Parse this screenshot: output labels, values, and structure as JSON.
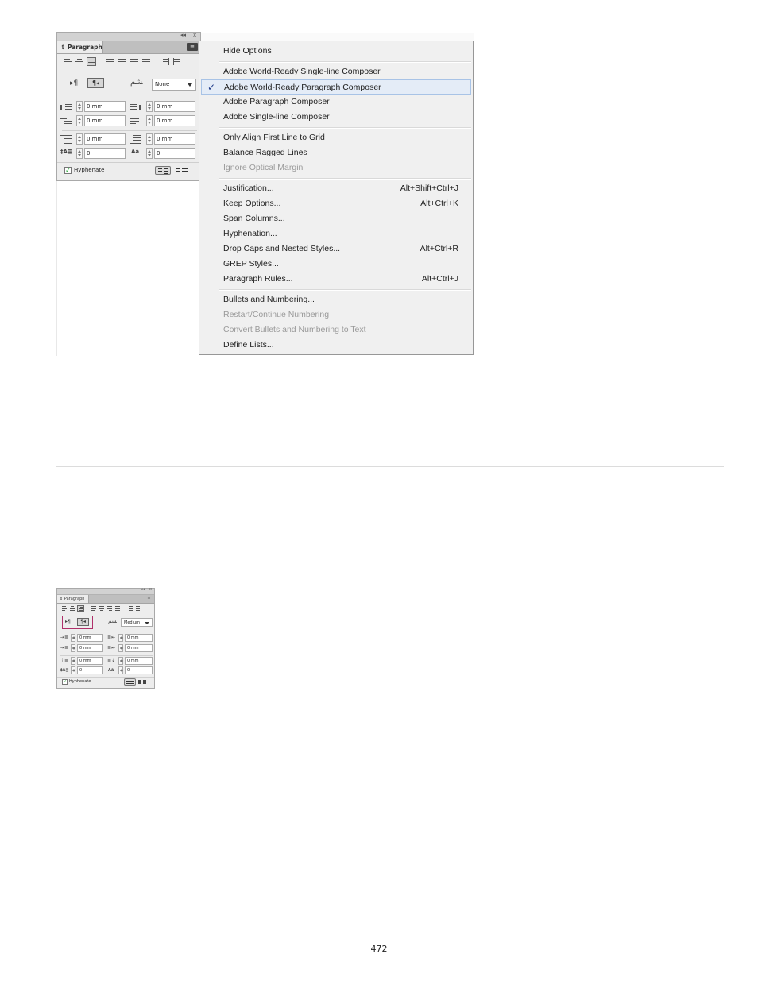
{
  "panel_large": {
    "title": "Paragraph",
    "title_icon": "updown-arrows-icon",
    "collapse_ctl": "◂◂",
    "close_ctl": "x",
    "menu_icon": "panel-menu-icon",
    "language_select": "None",
    "fields": {
      "left_indent": "0 mm",
      "right_indent": "0 mm",
      "first_line_indent": "0 mm",
      "last_line_right_indent": "0 mm",
      "space_before": "0 mm",
      "space_after": "0 mm",
      "drop_cap_lines": "0",
      "drop_cap_chars": "0"
    },
    "hyphenate_label": "Hyphenate",
    "hyphenate_checked": true
  },
  "menu": {
    "groups": [
      [
        {
          "label": "Hide Options",
          "shortcut": "",
          "disabled": false,
          "checked": false
        }
      ],
      [
        {
          "label": "Adobe World-Ready Single-line Composer",
          "shortcut": "",
          "disabled": false,
          "checked": false
        },
        {
          "label": "Adobe World-Ready Paragraph Composer",
          "shortcut": "",
          "disabled": false,
          "checked": true
        },
        {
          "label": "Adobe Paragraph Composer",
          "shortcut": "",
          "disabled": false,
          "checked": false
        },
        {
          "label": "Adobe Single-line Composer",
          "shortcut": "",
          "disabled": false,
          "checked": false
        }
      ],
      [
        {
          "label": "Only Align First Line to Grid",
          "shortcut": "",
          "disabled": false,
          "checked": false
        },
        {
          "label": "Balance Ragged Lines",
          "shortcut": "",
          "disabled": false,
          "checked": false
        },
        {
          "label": "Ignore Optical Margin",
          "shortcut": "",
          "disabled": true,
          "checked": false
        }
      ],
      [
        {
          "label": "Justification...",
          "shortcut": "Alt+Shift+Ctrl+J",
          "disabled": false,
          "checked": false
        },
        {
          "label": "Keep Options...",
          "shortcut": "Alt+Ctrl+K",
          "disabled": false,
          "checked": false
        },
        {
          "label": "Span Columns...",
          "shortcut": "",
          "disabled": false,
          "checked": false
        },
        {
          "label": "Hyphenation...",
          "shortcut": "",
          "disabled": false,
          "checked": false
        },
        {
          "label": "Drop Caps and Nested Styles...",
          "shortcut": "Alt+Ctrl+R",
          "disabled": false,
          "checked": false
        },
        {
          "label": "GREP Styles...",
          "shortcut": "",
          "disabled": false,
          "checked": false
        },
        {
          "label": "Paragraph Rules...",
          "shortcut": "Alt+Ctrl+J",
          "disabled": false,
          "checked": false
        }
      ],
      [
        {
          "label": "Bullets and Numbering...",
          "shortcut": "",
          "disabled": false,
          "checked": false
        },
        {
          "label": "Restart/Continue Numbering",
          "shortcut": "",
          "disabled": true,
          "checked": false
        },
        {
          "label": "Convert Bullets and Numbering to Text",
          "shortcut": "",
          "disabled": true,
          "checked": false
        },
        {
          "label": "Define Lists...",
          "shortcut": "",
          "disabled": false,
          "checked": false
        }
      ]
    ],
    "check_glyph": "✓"
  },
  "panel_small": {
    "title": "Paragraph",
    "collapse_ctl": "◂◂",
    "close_ctl": "x",
    "language_select": "Medium",
    "fields": {
      "left_indent": "0 mm",
      "right_indent": "0 mm",
      "first_line_indent": "0 mm",
      "last_line_right_indent": "0 mm",
      "space_before": "0 mm",
      "space_after": "0 mm",
      "drop_cap_lines": "0",
      "drop_cap_chars": "0"
    },
    "hyphenate_label": "Hyphenate",
    "highlight_color": "#b0306a"
  },
  "page_number": "472"
}
